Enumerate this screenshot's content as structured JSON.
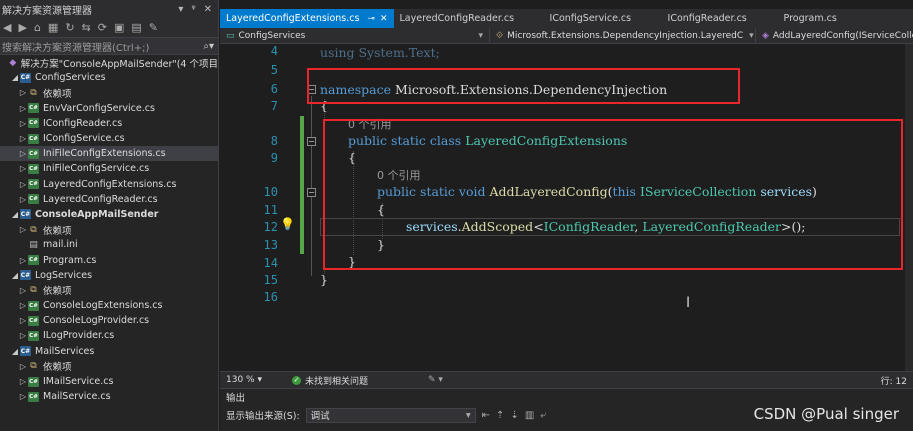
{
  "solution_explorer": {
    "title": "解决方案资源管理器",
    "search_placeholder": "搜索解决方案资源管理器(Ctrl+;)",
    "tree": [
      {
        "label": "解决方案\"ConsoleAppMailSender\"(4 个项目",
        "kind": "solution",
        "indent": 0,
        "arrow": ""
      },
      {
        "label": "ConfigServices",
        "kind": "project",
        "indent": 1,
        "arrow": "◢"
      },
      {
        "label": "依赖项",
        "kind": "dep",
        "indent": 2,
        "arrow": "▷"
      },
      {
        "label": "EnvVarConfigService.cs",
        "kind": "cs",
        "indent": 2,
        "arrow": "▷"
      },
      {
        "label": "IConfigReader.cs",
        "kind": "cs",
        "indent": 2,
        "arrow": "▷"
      },
      {
        "label": "IConfigService.cs",
        "kind": "cs",
        "indent": 2,
        "arrow": "▷"
      },
      {
        "label": "IniFileConfigExtensions.cs",
        "kind": "cs",
        "indent": 2,
        "arrow": "▷",
        "selected": true
      },
      {
        "label": "IniFileConfigService.cs",
        "kind": "cs",
        "indent": 2,
        "arrow": "▷"
      },
      {
        "label": "LayeredConfigExtensions.cs",
        "kind": "cs",
        "indent": 2,
        "arrow": "▷"
      },
      {
        "label": "LayeredConfigReader.cs",
        "kind": "cs",
        "indent": 2,
        "arrow": "▷"
      },
      {
        "label": "ConsoleAppMailSender",
        "kind": "project",
        "indent": 1,
        "arrow": "◢",
        "bold": true
      },
      {
        "label": "依赖项",
        "kind": "dep",
        "indent": 2,
        "arrow": "▷"
      },
      {
        "label": "mail.ini",
        "kind": "file",
        "indent": 2,
        "arrow": ""
      },
      {
        "label": "Program.cs",
        "kind": "cs",
        "indent": 2,
        "arrow": "▷"
      },
      {
        "label": "LogServices",
        "kind": "project",
        "indent": 1,
        "arrow": "◢"
      },
      {
        "label": "依赖项",
        "kind": "dep",
        "indent": 2,
        "arrow": "▷"
      },
      {
        "label": "ConsoleLogExtensions.cs",
        "kind": "cs",
        "indent": 2,
        "arrow": "▷"
      },
      {
        "label": "ConsoleLogProvider.cs",
        "kind": "cs",
        "indent": 2,
        "arrow": "▷"
      },
      {
        "label": "ILogProvider.cs",
        "kind": "cs",
        "indent": 2,
        "arrow": "▷"
      },
      {
        "label": "MailServices",
        "kind": "project",
        "indent": 1,
        "arrow": "◢"
      },
      {
        "label": "依赖项",
        "kind": "dep",
        "indent": 2,
        "arrow": "▷"
      },
      {
        "label": "IMailService.cs",
        "kind": "cs",
        "indent": 2,
        "arrow": "▷"
      },
      {
        "label": "MailService.cs",
        "kind": "cs",
        "indent": 2,
        "arrow": "▷"
      }
    ]
  },
  "tabs": [
    {
      "label": "LayeredConfigExtensions.cs",
      "active": true,
      "pin": "⊸",
      "close": "✕"
    },
    {
      "label": "LayeredConfigReader.cs"
    },
    {
      "label": "IConfigService.cs"
    },
    {
      "label": "IConfigReader.cs"
    },
    {
      "label": "Program.cs"
    }
  ],
  "nav": {
    "project": "ConfigServices",
    "namespace": "Microsoft.Extensions.DependencyInjection.LayeredC",
    "member": "AddLayeredConfig(IServiceCollection"
  },
  "editor": {
    "line_numbers": [
      "4",
      "5",
      "6",
      "7",
      "8",
      "9",
      "10",
      "11",
      "12",
      "13",
      "14",
      "15",
      "16"
    ],
    "refs_label_class": "0 个引用",
    "refs_label_method": "0 个引用",
    "line4": "using System.Text;",
    "line6_kw": "namespace",
    "line6_ns": "Microsoft.Extensions.DependencyInjection",
    "brace_open": "{",
    "brace_close": "}",
    "line8_kw": "public static class",
    "line8_type": "LayeredConfigExtensions",
    "line10_kw": "public static void",
    "line10_fn": "AddLayeredConfig",
    "line10_this": "this",
    "line10_type": "IServiceCollection",
    "line10_param": "services",
    "line12_obj": "services",
    "line12_fn": "AddScoped",
    "line12_t1": "IConfigReader",
    "line12_t2": "LayeredConfigReader"
  },
  "status": {
    "zoom": "130 %",
    "issues": "未找到相关问题",
    "position": "行: 12"
  },
  "output": {
    "title": "输出",
    "source_label": "显示输出来源(S):",
    "source_value": "调试"
  },
  "watermark": "CSDN @Pual singer",
  "colors": {
    "accent": "#007acc",
    "highlight_box": "#e8262b",
    "keyword": "#569cd6",
    "type": "#4ec9b0"
  }
}
